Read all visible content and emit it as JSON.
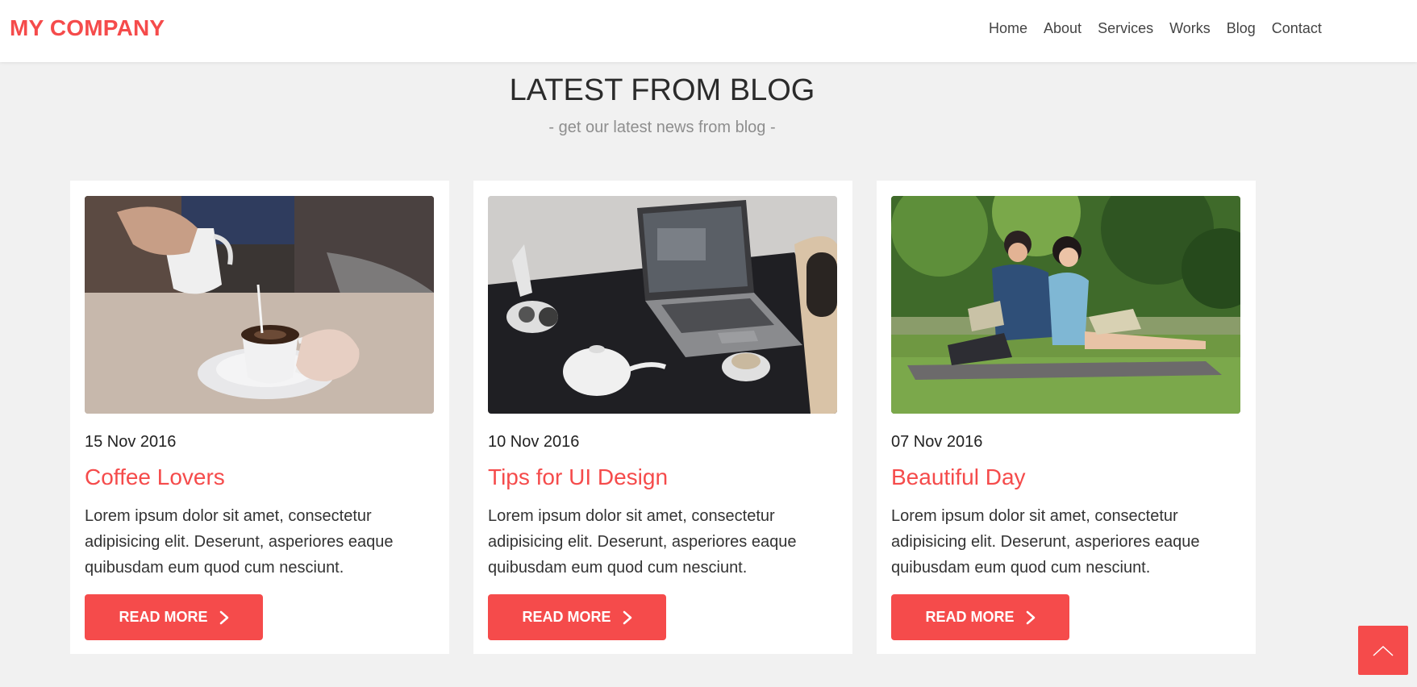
{
  "header": {
    "brand": "MY COMPANY",
    "nav": [
      {
        "label": "Home"
      },
      {
        "label": "About"
      },
      {
        "label": "Services"
      },
      {
        "label": "Works"
      },
      {
        "label": "Blog"
      },
      {
        "label": "Contact"
      }
    ]
  },
  "section": {
    "title": "LATEST FROM BLOG",
    "subtitle": "- get our latest news from blog -"
  },
  "posts": [
    {
      "date": "15 Nov 2016",
      "title": "Coffee Lovers",
      "excerpt": "Lorem ipsum dolor sit amet, consectetur adipisicing elit. Deserunt, asperiores eaque quibusdam eum quod cum nesciunt.",
      "button": "READ MORE"
    },
    {
      "date": "10 Nov 2016",
      "title": "Tips for UI Design",
      "excerpt": "Lorem ipsum dolor sit amet, consectetur adipisicing elit. Deserunt, asperiores eaque quibusdam eum quod cum nesciunt.",
      "button": "READ MORE"
    },
    {
      "date": "07 Nov 2016",
      "title": "Beautiful Day",
      "excerpt": "Lorem ipsum dolor sit amet, consectetur adipisicing elit. Deserunt, asperiores eaque quibusdam eum quod cum nesciunt.",
      "button": "READ MORE"
    }
  ],
  "icons": {
    "read_more": "chevron-right-icon",
    "back_to_top": "chevron-up-icon"
  },
  "colors": {
    "accent": "#f54b4b",
    "background": "#f1f1f1",
    "card": "#ffffff"
  }
}
